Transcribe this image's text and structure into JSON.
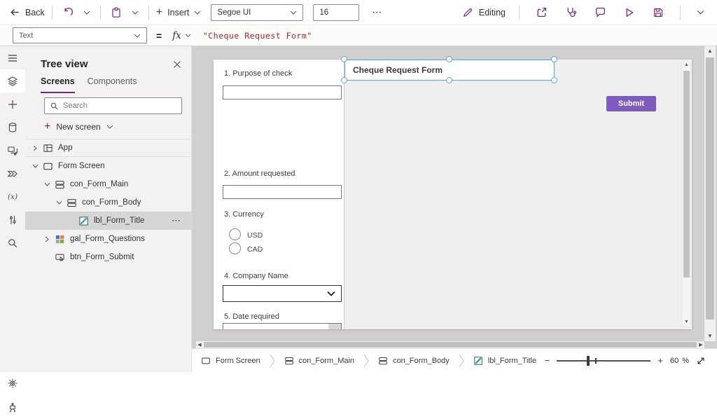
{
  "topbar": {
    "back_label": "Back",
    "insert_plus": "+",
    "insert_label": "Insert",
    "font_family_value": "Segoe UI",
    "font_size_value": "16",
    "overflow_label": "⋯",
    "editing_label": "Editing"
  },
  "formula_bar": {
    "property_value": "Text",
    "equals_sign": "=",
    "fx_label": "fx",
    "formula": "\"Cheque Request Form\"",
    "string_color": "#a4262c"
  },
  "left_rail": {
    "variables_glyph": "(x)"
  },
  "tree_panel": {
    "title": "Tree view",
    "tabs": [
      {
        "label": "Screens"
      },
      {
        "label": "Components"
      }
    ],
    "search_placeholder": "Search",
    "new_screen_plus": "+",
    "new_screen_label": "New screen",
    "items": [
      {
        "label": "App"
      },
      {
        "label": "Form Screen"
      },
      {
        "label": "con_Form_Main"
      },
      {
        "label": "con_Form_Body"
      },
      {
        "label": "lbl_Form_Title",
        "overflow": "⋯"
      },
      {
        "label": "gal_Form_Questions"
      },
      {
        "label": "btn_Form_Submit"
      }
    ]
  },
  "canvas": {
    "title_label": "Cheque Request Form",
    "submit_label": "Submit",
    "questions": [
      {
        "label": "1. Purpose of check"
      },
      {
        "label": "2. Amount requested"
      },
      {
        "label": "3. Currency",
        "options": [
          "USD",
          "CAD"
        ]
      },
      {
        "label": "4. Company Name"
      },
      {
        "label": "5. Date required"
      }
    ],
    "colors": {
      "submit_bg": "#7e5cbe",
      "selection": "#5ba4d9",
      "accent": "#742774"
    }
  },
  "breadcrumb": {
    "items": [
      {
        "label": "Form Screen"
      },
      {
        "label": "con_Form_Main"
      },
      {
        "label": "con_Form_Body"
      },
      {
        "label": "lbl_Form_Title"
      }
    ]
  },
  "zoom_controls": {
    "minus": "−",
    "plus": "+",
    "value": "60",
    "percent": "%"
  }
}
